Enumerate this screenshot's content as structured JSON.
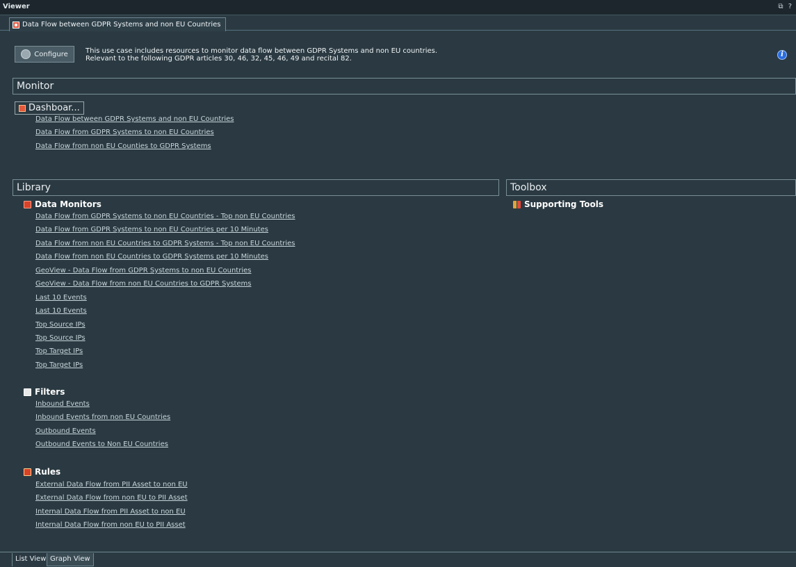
{
  "window": {
    "title": "Viewer",
    "controls": [
      "⧉",
      "?"
    ]
  },
  "tab": {
    "label": "Data Flow between GDPR Systems and non EU Countries"
  },
  "header": {
    "configure_label": "Configure",
    "description_line1": "This use case includes resources to monitor data flow between GDPR Systems and non EU countries.",
    "description_line2": "Relevant to the following GDPR articles 30, 46, 32, 45, 46, 49 and recital 82.",
    "info_glyph": "i"
  },
  "monitor": {
    "title": "Monitor",
    "dashboard_label": "Dashboar...",
    "links": [
      "Data Flow between GDPR Systems and non EU Countries",
      "Data Flow from GDPR Systems to non EU Countries",
      "Data Flow from non EU Counties to GDPR Systems"
    ]
  },
  "library": {
    "title": "Library",
    "data_monitors": {
      "title": "Data Monitors",
      "items": [
        "Data Flow from GDPR Systems to non EU Countries - Top non EU Countries",
        "Data Flow from GDPR Systems to non EU Countries per 10 Minutes",
        "Data Flow from non EU Countries to GDPR Systems - Top non EU Countries",
        "Data Flow from non EU Countries to GDPR Systems per 10 Minutes",
        "GeoView - Data Flow from GDPR Systems to non EU Countries",
        "GeoView - Data Flow from non EU Countries to GDPR Systems",
        "Last 10 Events",
        "Last 10 Events",
        "Top Source IPs",
        "Top Source IPs",
        "Top Target IPs",
        "Top Target IPs"
      ]
    },
    "filters": {
      "title": "Filters",
      "items": [
        "Inbound Events",
        "Inbound Events from non EU Countries",
        "Outbound Events",
        "Outbound Events to Non EU Countries"
      ]
    },
    "rules": {
      "title": "Rules",
      "items": [
        "External Data Flow from PII Asset to non EU",
        "External Data Flow from non EU to PII Asset",
        "Internal Data Flow from PII Asset to non EU",
        "Internal Data Flow from non EU to PII Asset"
      ]
    }
  },
  "toolbox": {
    "title": "Toolbox",
    "supporting_tools": "Supporting Tools"
  },
  "bottom_tabs": {
    "list_view": "List View",
    "graph_view": "Graph View"
  },
  "colors": {
    "background": "#2b3a42",
    "link": "#c8d4da",
    "info_blue": "#2a6de0",
    "accent_red": "#d9432a"
  }
}
